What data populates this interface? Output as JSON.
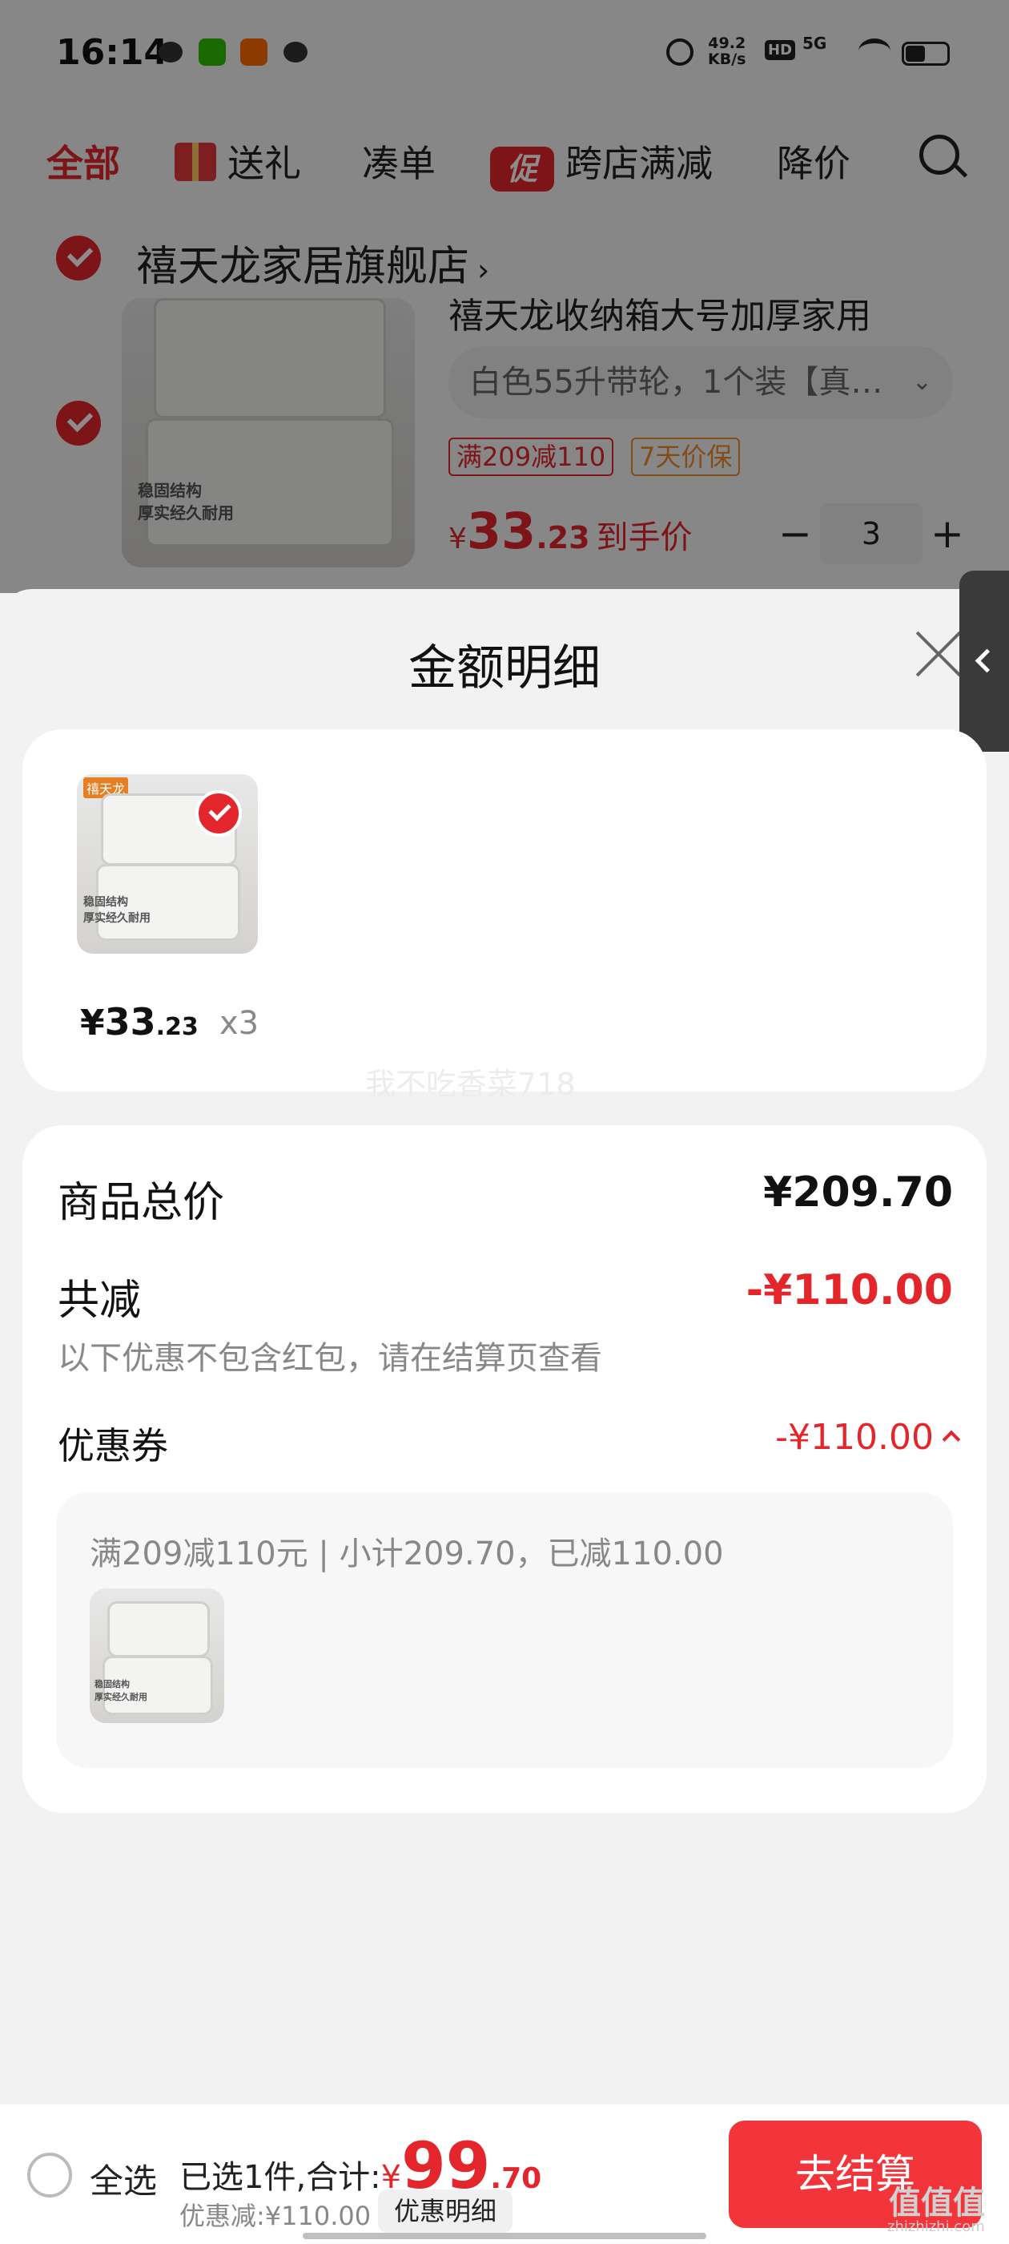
{
  "status_bar": {
    "time": "16:14",
    "net_speed_value": "49.2",
    "net_speed_unit": "KB/s",
    "hd": "HD",
    "signal": "5G",
    "icons": [
      "wechat-moments-icon",
      "wechat-icon",
      "taobao-icon",
      "wechat-icon",
      "alarm-icon",
      "wifi-icon",
      "battery-icon"
    ]
  },
  "tabs": [
    {
      "label": "全部"
    },
    {
      "label": "送礼"
    },
    {
      "label": "凑单"
    },
    {
      "label": "跨店满减",
      "badge": "促"
    },
    {
      "label": "降价"
    }
  ],
  "shop": {
    "name": "禧天龙家居旗舰店",
    "arrow": "›"
  },
  "cart_item": {
    "title": "禧天龙收纳箱大号加厚家用",
    "sku": "白色55升带轮，1个装【真…",
    "tags": [
      "满209减110",
      "7天价保"
    ],
    "image_text": [
      "稳固结构",
      "厚实经久耐用"
    ],
    "price": {
      "currency": "¥",
      "int": "33",
      "dec": ".23",
      "label": "到手价"
    },
    "quantity": "3"
  },
  "sheet": {
    "title": "金额明细",
    "item": {
      "brand_tag": "禧天龙",
      "image_text": [
        "稳固结构",
        "厚实经久耐用"
      ],
      "price_currency": "¥",
      "price_int": "33",
      "price_dec": ".23",
      "qty": "x3"
    },
    "watermark": "我不吃香菜718",
    "total_label": "商品总价",
    "total_value": "¥209.70",
    "reduce_label": "共减",
    "reduce_value": "-¥110.00",
    "reduce_note": "以下优惠不包含红包，请在结算页查看",
    "coupon_label": "优惠券",
    "coupon_value": "-¥110.00",
    "coupon_desc": "满209减110元 | 小计209.70，已减110.00",
    "coupon_image_text": [
      "稳固结构",
      "厚实经久耐用"
    ]
  },
  "bottom_bar": {
    "select_all": "全选",
    "selected_prefix": "已选1件,合计:",
    "currency": "¥",
    "total_int": "99",
    "total_dec": ".70",
    "discount": "优惠减:¥110.00",
    "detail_button": "优惠明细",
    "checkout": "去结算",
    "watermark": "值值值",
    "watermark_sub": "zhizhizhi.com"
  },
  "colors": {
    "accent": "#e3262b",
    "checkout": "#f2353b",
    "sheet_bg": "#f2f2f2"
  }
}
